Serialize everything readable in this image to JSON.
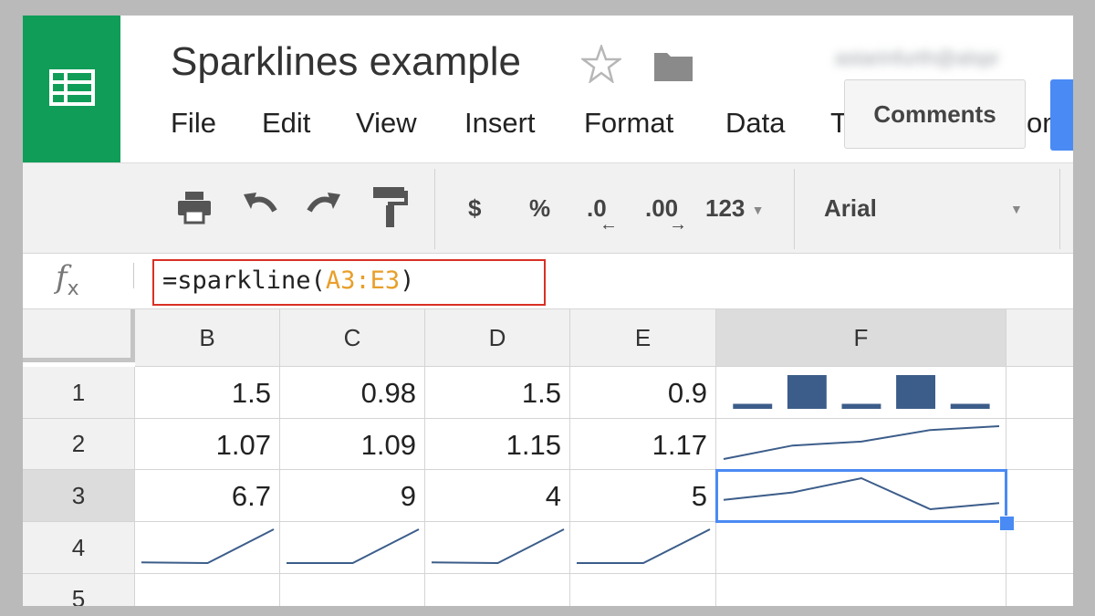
{
  "header": {
    "title": "Sparklines example",
    "account_email": "astarinfurth@alspr",
    "menu": [
      "File",
      "Edit",
      "View",
      "Insert",
      "Format",
      "Data",
      "T",
      "on"
    ],
    "comments_label": "Comments"
  },
  "toolbar": {
    "currency": "$",
    "percent": "%",
    "decrease_decimals": ".0",
    "increase_decimals": ".00",
    "more_formats": "123",
    "font_name": "Arial"
  },
  "formula_bar": {
    "prefix": "=sparkline(",
    "range": "A3:E3",
    "suffix": ")"
  },
  "grid": {
    "columns": [
      "B",
      "C",
      "D",
      "E",
      "F"
    ],
    "rows": [
      "1",
      "2",
      "3",
      "4",
      "5"
    ],
    "cells": [
      [
        "1.5",
        "0.98",
        "1.5",
        "0.9"
      ],
      [
        "1.07",
        "1.09",
        "1.15",
        "1.17"
      ],
      [
        "6.7",
        "9",
        "4",
        "5"
      ]
    ],
    "selected_cell": "F3"
  },
  "sparklines": {
    "row1_column": [
      0.9,
      6,
      0.9,
      6,
      0.9
    ],
    "row2_line": [
      1.0,
      1.07,
      1.09,
      1.15,
      1.17
    ],
    "row3_line": [
      5.5,
      6.7,
      9,
      4,
      5
    ],
    "row4_lines": [
      [
        1,
        0.9,
        6
      ],
      [
        1,
        1.0,
        6
      ],
      [
        1,
        0.9,
        6
      ],
      [
        1,
        1.0,
        6
      ]
    ]
  },
  "colors": {
    "brand": "#0f9d58",
    "selection": "#4a8af4",
    "sparkline": "#3c5d8a",
    "formula_highlight": "#d93025",
    "range_text": "#e89f2a"
  }
}
